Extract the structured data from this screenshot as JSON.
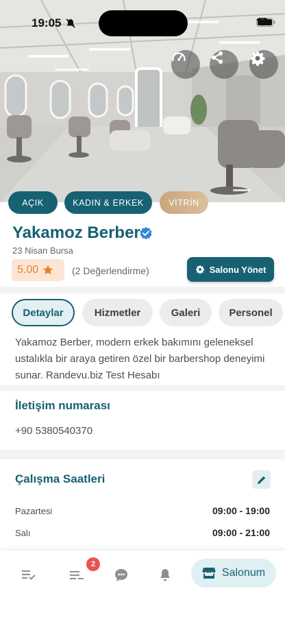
{
  "status_bar": {
    "time": "19:05"
  },
  "hero": {
    "buttons": [
      {
        "name": "speedometer-icon"
      },
      {
        "name": "share-icon"
      },
      {
        "name": "gear-icon"
      }
    ]
  },
  "chips": {
    "open": "AÇIK",
    "gender": "KADIN & ERKEK",
    "showcase": "VİTRİN"
  },
  "salon": {
    "name": "Yakamoz Berber",
    "address": "23 Nisan Bursa",
    "rating": "5.00",
    "reviews": "(2 Değerlendirme)",
    "manage_label": "Salonu Yönet"
  },
  "tabs": [
    {
      "label": "Detaylar",
      "active": true
    },
    {
      "label": "Hizmetler",
      "active": false
    },
    {
      "label": "Galeri",
      "active": false
    },
    {
      "label": "Personel",
      "active": false
    }
  ],
  "description": "Yakamoz Berber, modern erkek bakımını geleneksel ustalıkla bir araya getiren özel bir barbershop deneyimi sunar. Randevu.biz Test Hesabı",
  "contact": {
    "title": "İletişim numarası",
    "phone": "+90 5380540370"
  },
  "working_hours": {
    "title": "Çalışma Saatleri",
    "days": [
      {
        "day": "Pazartesi",
        "hours": "09:00 - 19:00"
      },
      {
        "day": "Salı",
        "hours": "09:00 - 21:00"
      }
    ]
  },
  "bottom_nav": {
    "badge_count": "2",
    "active_label": "Salonum"
  },
  "colors": {
    "primary": "#176173",
    "rating_star": "#e8802b",
    "showcase_chip": "#d6b38a",
    "badge": "#e9534f"
  }
}
